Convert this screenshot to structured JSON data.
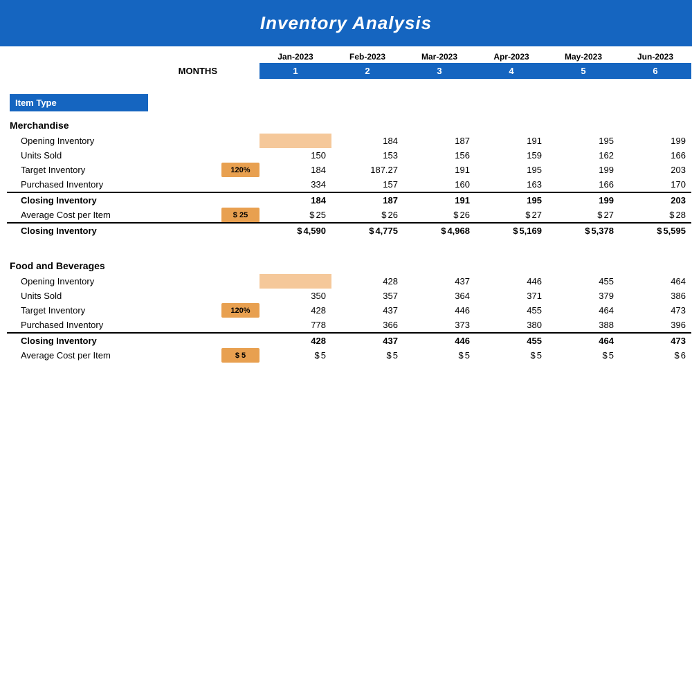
{
  "title": "Inventory Analysis",
  "months": {
    "labels": [
      "Jan-2023",
      "Feb-2023",
      "Mar-2023",
      "Apr-2023",
      "May-2023",
      "Jun-2023"
    ],
    "numbers": [
      "1",
      "2",
      "3",
      "4",
      "5",
      "6"
    ],
    "months_label": "MONTHS"
  },
  "item_type_label": "Item Type",
  "merchandise": {
    "category": "Merchandise",
    "rows": {
      "opening_inventory": {
        "label": "Opening Inventory",
        "values": [
          "",
          "184",
          "187",
          "191",
          "195",
          "199"
        ],
        "jan_orange": true
      },
      "units_sold": {
        "label": "Units Sold",
        "values": [
          "150",
          "153",
          "156",
          "159",
          "162",
          "166"
        ]
      },
      "target_inventory": {
        "label": "Target Inventory",
        "prefix": "120%",
        "values": [
          "184",
          "187.27",
          "191",
          "195",
          "199",
          "203"
        ]
      },
      "purchased_inventory": {
        "label": "Purchased Inventory",
        "values": [
          "334",
          "157",
          "160",
          "163",
          "166",
          "170"
        ]
      },
      "closing_inventory_units": {
        "label": "Closing Inventory",
        "bold": true,
        "values": [
          "184",
          "187",
          "191",
          "195",
          "199",
          "203"
        ]
      },
      "avg_cost_per_item": {
        "label": "Average Cost per Item",
        "prefix": "$ 25",
        "values": [
          "25",
          "26",
          "26",
          "27",
          "27",
          "28"
        ]
      },
      "closing_inventory_dollar": {
        "label": "Closing Inventory",
        "bold": true,
        "values": [
          "4,590",
          "4,775",
          "4,968",
          "5,169",
          "5,378",
          "5,595"
        ]
      }
    }
  },
  "food_and_beverages": {
    "category": "Food and Beverages",
    "rows": {
      "opening_inventory": {
        "label": "Opening Inventory",
        "values": [
          "",
          "428",
          "437",
          "446",
          "455",
          "464"
        ],
        "jan_orange": true
      },
      "units_sold": {
        "label": "Units Sold",
        "values": [
          "350",
          "357",
          "364",
          "371",
          "379",
          "386"
        ]
      },
      "target_inventory": {
        "label": "Target Inventory",
        "prefix": "120%",
        "values": [
          "428",
          "437",
          "446",
          "455",
          "464",
          "473"
        ]
      },
      "purchased_inventory": {
        "label": "Purchased Inventory",
        "values": [
          "778",
          "366",
          "373",
          "380",
          "388",
          "396"
        ]
      },
      "closing_inventory_units": {
        "label": "Closing Inventory",
        "bold": true,
        "values": [
          "428",
          "437",
          "446",
          "455",
          "464",
          "473"
        ]
      },
      "avg_cost_per_item": {
        "label": "Average Cost per Item",
        "prefix": "$ 5",
        "values": [
          "5",
          "5",
          "5",
          "5",
          "5",
          "6"
        ]
      }
    }
  }
}
